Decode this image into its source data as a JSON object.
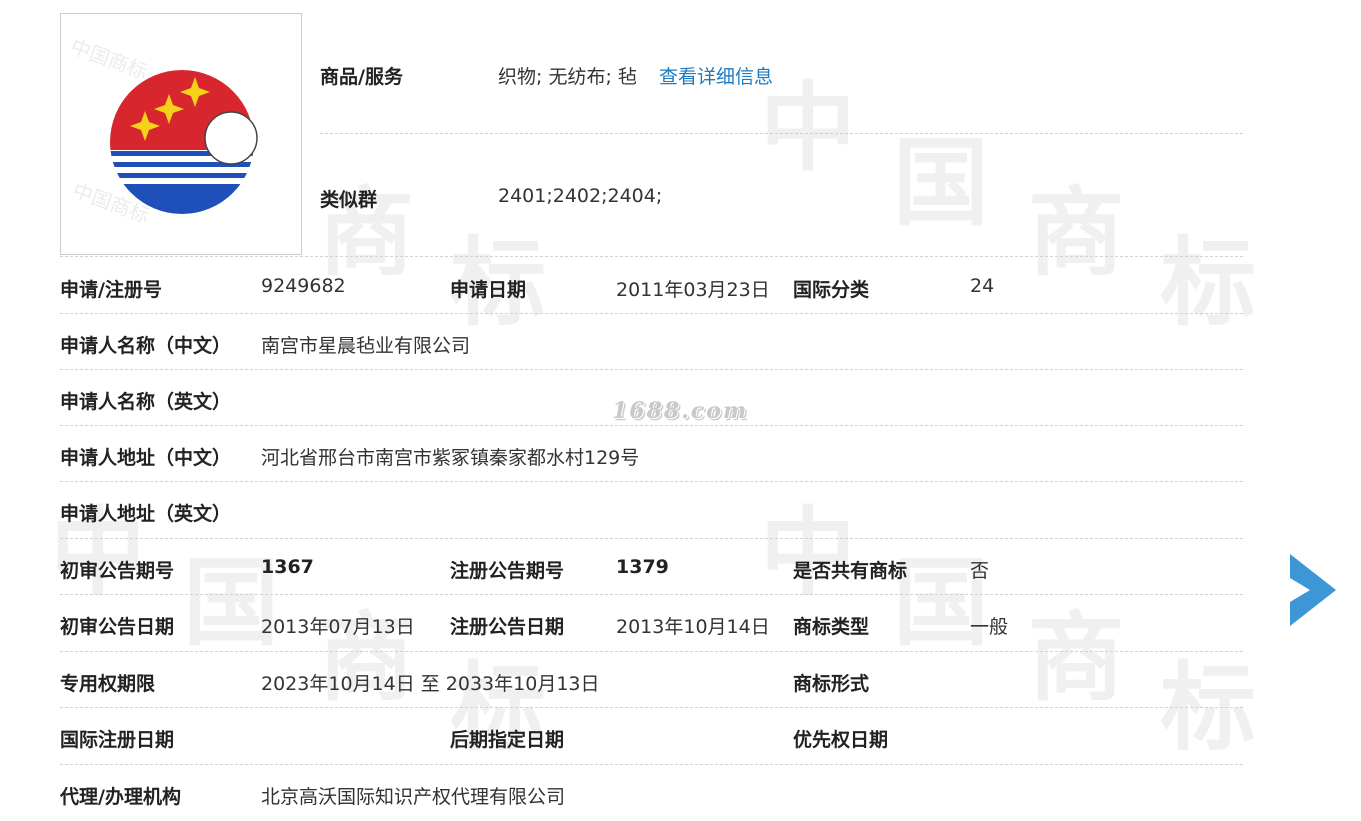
{
  "watermark": {
    "chars": [
      "中",
      "国",
      "商",
      "标"
    ],
    "site": "1688.com"
  },
  "trademark_image": {
    "colors": {
      "red": "#d8262e",
      "blue": "#1f4fb8",
      "star": "#f6d11a"
    }
  },
  "goods": {
    "label": "商品/服务",
    "value": "织物; 无纺布; 毡",
    "detail_link": "查看详细信息"
  },
  "similar_group": {
    "label": "类似群",
    "value": "2401;2402;2404;"
  },
  "details": {
    "reg_no_label": "申请/注册号",
    "reg_no": "9249682",
    "apply_date_label": "申请日期",
    "apply_date": "2011年03月23日",
    "intl_class_label": "国际分类",
    "intl_class": "24",
    "applicant_cn_label": "申请人名称（中文）",
    "applicant_cn": "南宫市星晨毡业有限公司",
    "applicant_en_label": "申请人名称（英文）",
    "applicant_en": "",
    "address_cn_label": "申请人地址（中文）",
    "address_cn": "河北省邢台市南宫市紫冢镇秦家都水村129号",
    "address_en_label": "申请人地址（英文）",
    "address_en": "",
    "prelim_issue_label": "初审公告期号",
    "prelim_issue": "1367",
    "reg_issue_label": "注册公告期号",
    "reg_issue": "1379",
    "shared_label": "是否共有商标",
    "shared": "否",
    "prelim_date_label": "初审公告日期",
    "prelim_date": "2013年07月13日",
    "reg_date_label": "注册公告日期",
    "reg_date": "2013年10月14日",
    "tm_type_label": "商标类型",
    "tm_type": "一般",
    "exclusive_term_label": "专用权期限",
    "exclusive_term": "2023年10月14日 至 2033年10月13日",
    "tm_form_label": "商标形式",
    "tm_form": "",
    "intl_reg_date_label": "国际注册日期",
    "intl_reg_date": "",
    "later_designation_label": "后期指定日期",
    "later_designation": "",
    "priority_date_label": "优先权日期",
    "priority_date": "",
    "agent_label": "代理/办理机构",
    "agent": "北京高沃国际知识产权代理有限公司"
  },
  "nav": {
    "next_icon": "chevron-right-icon",
    "color": "#3d97d6"
  }
}
